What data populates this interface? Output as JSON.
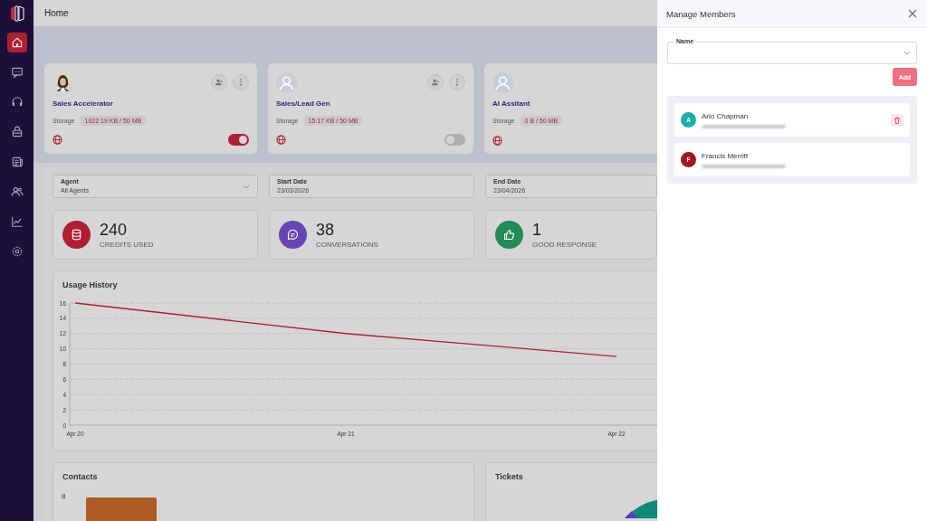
{
  "sidebar": {
    "items": [
      {
        "selected": true
      },
      {
        "selected": false
      },
      {
        "selected": false
      },
      {
        "selected": false
      },
      {
        "selected": false
      },
      {
        "selected": false
      },
      {
        "selected": false
      },
      {
        "selected": false
      }
    ]
  },
  "header": {
    "title": "Home"
  },
  "agents": [
    {
      "name": "Sales Accelerator",
      "storage_label": "Storage",
      "storage": "1022.19 KB / 50 MB",
      "toggle": true
    },
    {
      "name": "Sales/Lead Gen",
      "kind": "placeholder",
      "storage_label": "Storage",
      "storage": "15.17 KB / 50 MB",
      "toggle": false
    },
    {
      "name": "AI Assitant",
      "kind": "placeholder",
      "storage_label": "Storage",
      "storage": "0 B / 50 MB"
    }
  ],
  "filters": [
    {
      "label": "Agent",
      "value": "All Agents",
      "kind": "select"
    },
    {
      "label": "Start Date",
      "value": "23/03/2026",
      "kind": "date"
    },
    {
      "label": "End Date",
      "value": "23/04/2026",
      "kind": "date"
    }
  ],
  "stats": [
    {
      "value": "240",
      "label": "CREDITS USED",
      "color": "#af1e31"
    },
    {
      "value": "38",
      "label": "CONVERSATIONS",
      "color": "#6747b6"
    },
    {
      "value": "1",
      "label": "GOOD RESPONSE",
      "color": "#228b56"
    }
  ],
  "usage": {
    "title": "Usage History",
    "chart_data": {
      "type": "line",
      "categories": [
        "Apr 20",
        "Apr 21",
        "Apr 22",
        null
      ],
      "ylim": [
        0,
        16
      ],
      "yticks": [
        0,
        2,
        4,
        6,
        8,
        10,
        12,
        14,
        16
      ],
      "series": [
        {
          "color": "#af1e31",
          "values": [
            16,
            12,
            9,
            null
          ]
        }
      ]
    }
  },
  "contacts": {
    "title": "Contacts",
    "axis_tick": "8"
  },
  "tickets": {
    "title": "Tickets"
  },
  "drawer": {
    "title": "Manage Members",
    "field": {
      "label": "Name"
    },
    "add_button": "Add",
    "members": [
      {
        "initial": "A",
        "name": "Arlo Chapman",
        "color": "#18b0a8",
        "deletable": true
      },
      {
        "initial": "F",
        "name": "Francis Merritt",
        "color": "#a3161c",
        "deletable": false
      }
    ]
  }
}
